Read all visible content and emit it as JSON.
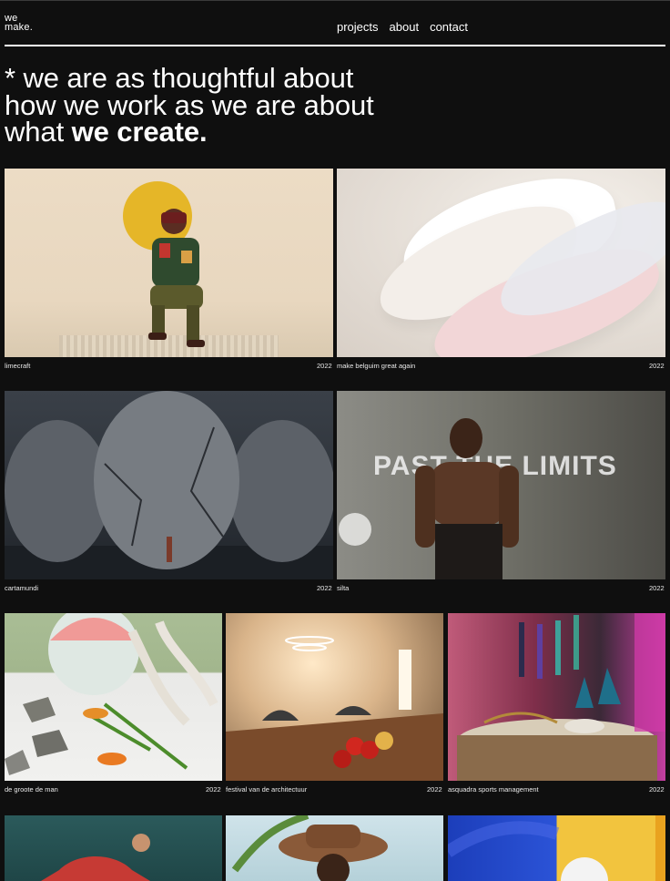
{
  "logo": {
    "line1": "we",
    "line2": "make."
  },
  "nav": {
    "projects": "projects",
    "about": "about",
    "contact": "contact"
  },
  "hero": {
    "text": "* we are as thoughtful about how we work as we are about what",
    "emphasis": "we create."
  },
  "projects": [
    {
      "name": "limecraft",
      "year": "2022"
    },
    {
      "name": "make belguim great again",
      "year": "2022"
    },
    {
      "name": "cartamundi",
      "year": "2022"
    },
    {
      "name": "silta",
      "year": "2022"
    },
    {
      "name": "de groote de man",
      "year": "2022"
    },
    {
      "name": "festival van de architectuur",
      "year": "2022"
    },
    {
      "name": "asquadra sports management",
      "year": "2022"
    }
  ],
  "image_text": {
    "silta_banner": "PAST THE LIMITS"
  },
  "colors": {
    "background": "#0f0f0f",
    "text": "#ffffff",
    "accent_yellow": "#e5b628"
  }
}
